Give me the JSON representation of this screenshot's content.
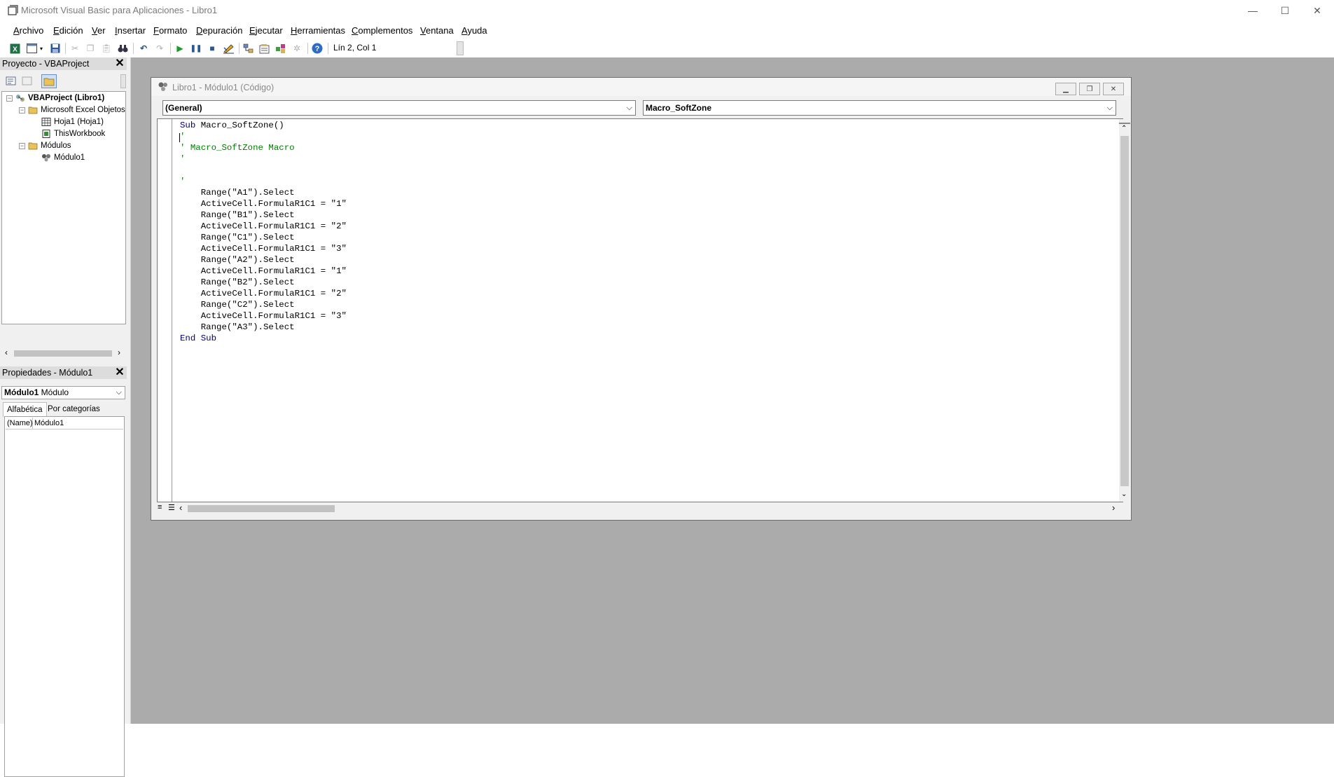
{
  "window": {
    "title": "Microsoft Visual Basic para Aplicaciones - Libro1",
    "minimize": "—",
    "maximize": "☐",
    "close": "✕"
  },
  "menu": {
    "items": [
      {
        "label": "Archivo",
        "accel": "A",
        "rest": "rchivo"
      },
      {
        "label": "Edición",
        "accel": "E",
        "rest": "dición"
      },
      {
        "label": "Ver",
        "accel": "V",
        "rest": "er"
      },
      {
        "label": "Insertar",
        "accel": "I",
        "rest": "nsertar"
      },
      {
        "label": "Formato",
        "accel": "F",
        "rest": "ormato"
      },
      {
        "label": "Depuración",
        "accel": "D",
        "rest": "epuración"
      },
      {
        "label": "Ejecutar",
        "accel": "E",
        "rest": "jecutar"
      },
      {
        "label": "Herramientas",
        "accel": "H",
        "rest": "erramientas"
      },
      {
        "label": "Complementos",
        "accel": "C",
        "rest": "omplementos"
      },
      {
        "label": "Ventana",
        "accel": "V",
        "rest": "entana"
      },
      {
        "label": "Ayuda",
        "accel": "A",
        "rest": "yuda"
      }
    ]
  },
  "toolbar": {
    "status": "Lín 2, Col 1",
    "icons": [
      "excel-icon",
      "insert-userform-icon",
      "save-icon",
      "cut-icon",
      "copy-icon",
      "paste-icon",
      "find-icon",
      "undo-icon",
      "redo-icon",
      "run-icon",
      "break-icon",
      "reset-icon",
      "design-mode-icon",
      "project-explorer-icon",
      "properties-icon",
      "object-browser-icon",
      "toolbox-icon",
      "help-icon"
    ]
  },
  "project_panel": {
    "title": "Proyecto - VBAProject",
    "tree": [
      {
        "label": "VBAProject (Libro1)",
        "bold": true
      },
      {
        "label": "Microsoft Excel Objetos"
      },
      {
        "label": "Hoja1 (Hoja1)"
      },
      {
        "label": "ThisWorkbook"
      },
      {
        "label": "Módulos"
      },
      {
        "label": "Módulo1"
      }
    ]
  },
  "properties_panel": {
    "title": "Propiedades - Módulo1",
    "object_name": "Módulo1",
    "object_type": "Módulo",
    "tabs": [
      "Alfabética",
      "Por categorías"
    ],
    "rows": [
      {
        "name": "(Name)",
        "value": "Módulo1"
      }
    ]
  },
  "code_window": {
    "title": "Libro1 - Módulo1 (Código)",
    "object_combo": "(General)",
    "procedure_combo": "Macro_SoftZone",
    "lines": [
      {
        "parts": [
          {
            "t": "Sub",
            "c": "kw"
          },
          {
            "t": " Macro_SoftZone()",
            "c": ""
          }
        ]
      },
      {
        "parts": [
          {
            "t": "'",
            "c": "cm"
          }
        ]
      },
      {
        "parts": [
          {
            "t": "' Macro_SoftZone Macro",
            "c": "cm"
          }
        ]
      },
      {
        "parts": [
          {
            "t": "'",
            "c": "cm"
          }
        ]
      },
      {
        "parts": [
          {
            "t": "",
            "c": ""
          }
        ]
      },
      {
        "parts": [
          {
            "t": "'",
            "c": "cm"
          }
        ]
      },
      {
        "parts": [
          {
            "t": "    Range(\"A1\").Select",
            "c": ""
          }
        ]
      },
      {
        "parts": [
          {
            "t": "    ActiveCell.FormulaR1C1 = \"1\"",
            "c": ""
          }
        ]
      },
      {
        "parts": [
          {
            "t": "    Range(\"B1\").Select",
            "c": ""
          }
        ]
      },
      {
        "parts": [
          {
            "t": "    ActiveCell.FormulaR1C1 = \"2\"",
            "c": ""
          }
        ]
      },
      {
        "parts": [
          {
            "t": "    Range(\"C1\").Select",
            "c": ""
          }
        ]
      },
      {
        "parts": [
          {
            "t": "    ActiveCell.FormulaR1C1 = \"3\"",
            "c": ""
          }
        ]
      },
      {
        "parts": [
          {
            "t": "    Range(\"A2\").Select",
            "c": ""
          }
        ]
      },
      {
        "parts": [
          {
            "t": "    ActiveCell.FormulaR1C1 = \"1\"",
            "c": ""
          }
        ]
      },
      {
        "parts": [
          {
            "t": "    Range(\"B2\").Select",
            "c": ""
          }
        ]
      },
      {
        "parts": [
          {
            "t": "    ActiveCell.FormulaR1C1 = \"2\"",
            "c": ""
          }
        ]
      },
      {
        "parts": [
          {
            "t": "    Range(\"C2\").Select",
            "c": ""
          }
        ]
      },
      {
        "parts": [
          {
            "t": "    ActiveCell.FormulaR1C1 = \"3\"",
            "c": ""
          }
        ]
      },
      {
        "parts": [
          {
            "t": "    Range(\"A3\").Select",
            "c": ""
          }
        ]
      },
      {
        "parts": [
          {
            "t": "End Sub",
            "c": "kw"
          }
        ]
      }
    ]
  },
  "colors": {
    "keyword": "#00007f",
    "comment": "#008000",
    "mdi_background": "#ababab"
  }
}
